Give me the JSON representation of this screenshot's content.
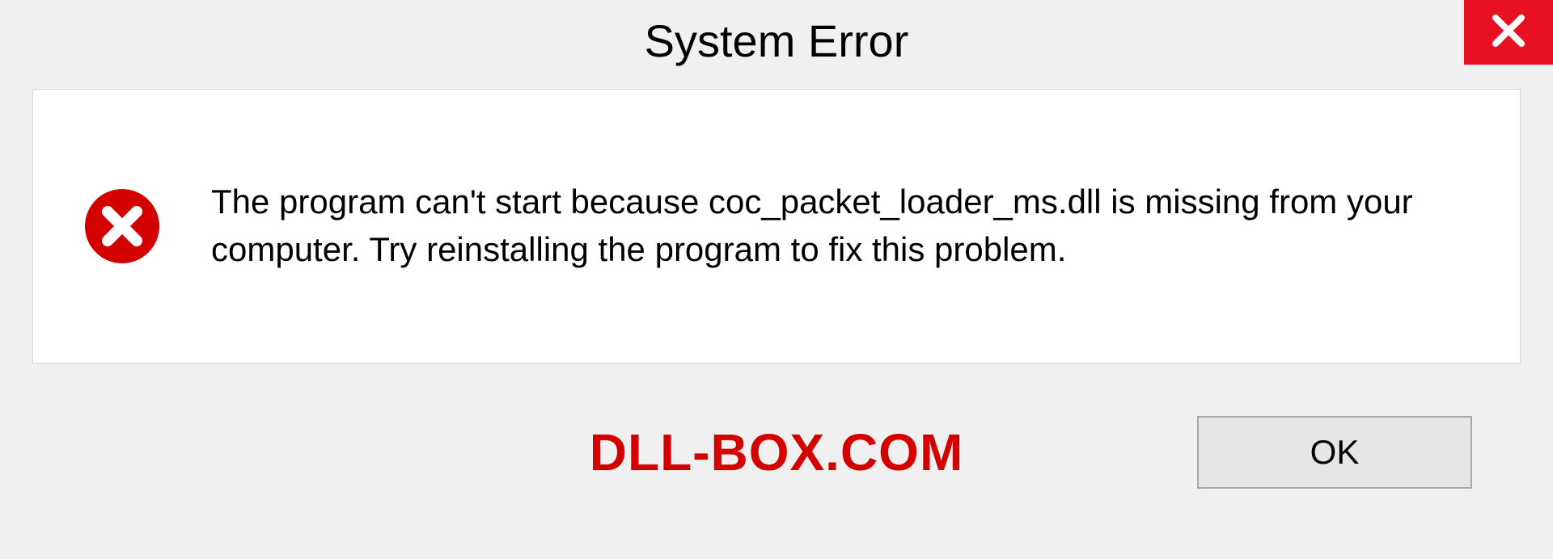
{
  "titlebar": {
    "title": "System Error"
  },
  "dialog": {
    "message": "The program can't start because coc_packet_loader_ms.dll is missing from your computer. Try reinstalling the program to fix this problem."
  },
  "footer": {
    "watermark": "DLL-BOX.COM",
    "ok_label": "OK"
  },
  "colors": {
    "close_bg": "#e81123",
    "error_red": "#d40000",
    "window_bg": "#f0f0f0",
    "content_bg": "#ffffff"
  }
}
